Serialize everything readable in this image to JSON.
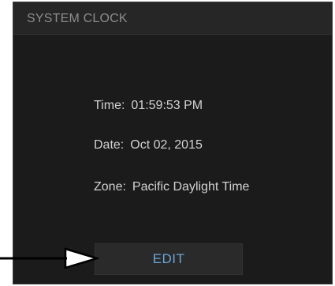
{
  "panel": {
    "title": "SYSTEM CLOCK"
  },
  "clock": {
    "time_label": "Time:",
    "time_value": "01:59:53 PM",
    "date_label": "Date:",
    "date_value": "Oct 02, 2015",
    "zone_label": "Zone:",
    "zone_value": "Pacific Daylight Time"
  },
  "actions": {
    "edit_label": "EDIT"
  },
  "colors": {
    "panel_background": "#1b1b1b",
    "header_background": "#262626",
    "header_text": "#8c8c8c",
    "body_text": "#d2d2d2",
    "button_background": "#2a2a2a",
    "button_text": "#6aa6d8",
    "callout": "#000000"
  },
  "icons": {
    "callout": "arrow-right-icon"
  }
}
